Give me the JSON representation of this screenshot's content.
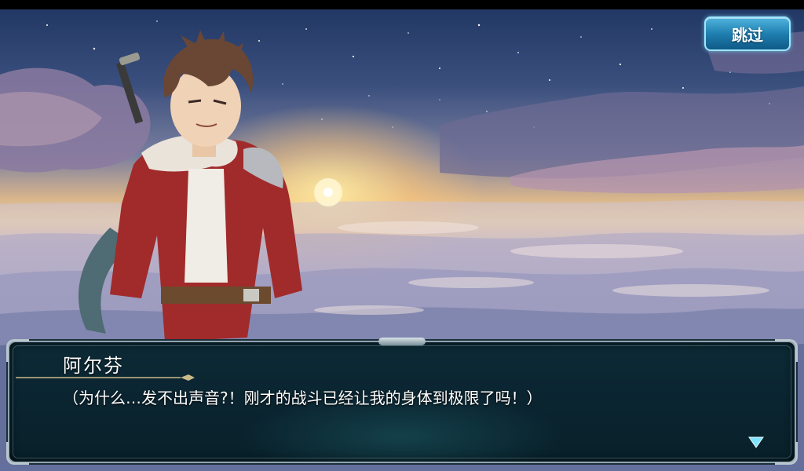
{
  "skip_button": {
    "label": "跳过"
  },
  "dialog": {
    "speaker": "阿尔芬",
    "text": "（为什么…发不出声音?！刚才的战斗已经让我的身体到极限了吗！）"
  },
  "icons": {
    "next": "triangle-down-icon"
  },
  "colors": {
    "skip_button": "#1f7fb0",
    "dialog_bg": "#0a2430",
    "frame": "#8fa3b0",
    "next_indicator": "#7fe3ff"
  }
}
